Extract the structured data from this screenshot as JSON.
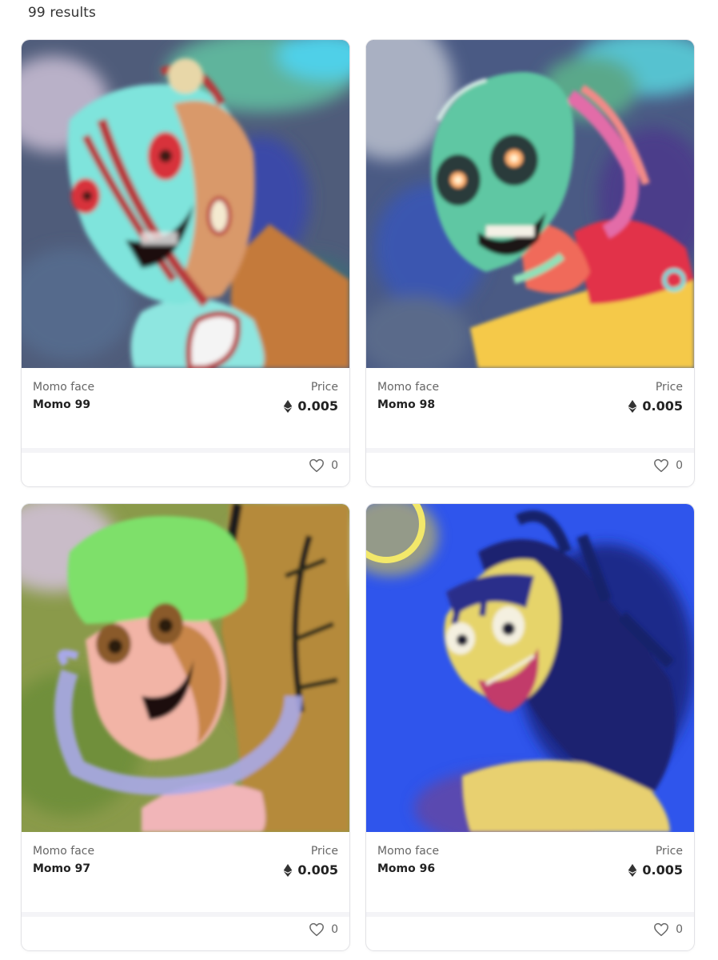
{
  "results_text": "99 results",
  "cards": [
    {
      "collection": "Momo face",
      "name": "Momo 99",
      "price_label": "Price",
      "price": "0.005",
      "likes": "0",
      "image": "momo-99-artwork"
    },
    {
      "collection": "Momo face",
      "name": "Momo 98",
      "price_label": "Price",
      "price": "0.005",
      "likes": "0",
      "image": "momo-98-artwork"
    },
    {
      "collection": "Momo face",
      "name": "Momo 97",
      "price_label": "Price",
      "price": "0.005",
      "likes": "0",
      "image": "momo-97-artwork"
    },
    {
      "collection": "Momo face",
      "name": "Momo 96",
      "price_label": "Price",
      "price": "0.005",
      "likes": "0",
      "image": "momo-96-artwork"
    }
  ],
  "icons": {
    "currency": "ethereum-icon",
    "like": "heart-icon"
  }
}
